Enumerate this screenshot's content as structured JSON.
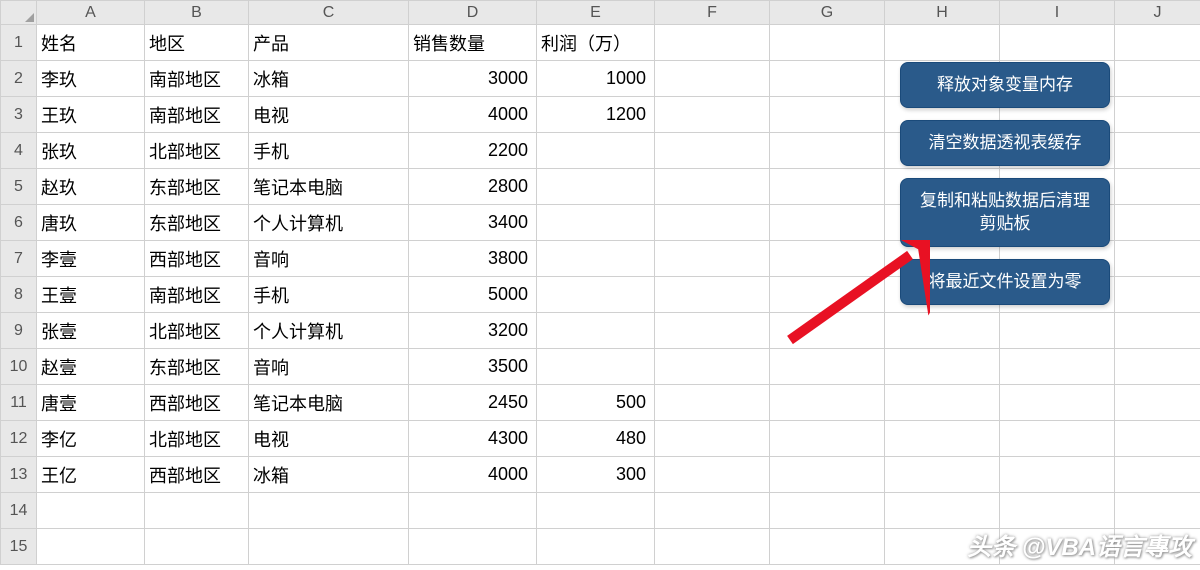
{
  "columns": [
    "A",
    "B",
    "C",
    "D",
    "E",
    "F",
    "G",
    "H",
    "I",
    "J"
  ],
  "rowCount": 15,
  "headers": {
    "c1": "姓名",
    "c2": "地区",
    "c3": "产品",
    "c4": "销售数量",
    "c5": "利润（万）"
  },
  "rows": [
    {
      "name": "李玖",
      "region": "南部地区",
      "product": "冰箱",
      "qty": "3000",
      "profit": "1000"
    },
    {
      "name": "王玖",
      "region": "南部地区",
      "product": "电视",
      "qty": "4000",
      "profit": "1200"
    },
    {
      "name": "张玖",
      "region": "北部地区",
      "product": "手机",
      "qty": "2200",
      "profit": ""
    },
    {
      "name": "赵玖",
      "region": "东部地区",
      "product": "笔记本电脑",
      "qty": "2800",
      "profit": ""
    },
    {
      "name": "唐玖",
      "region": "东部地区",
      "product": "个人计算机",
      "qty": "3400",
      "profit": ""
    },
    {
      "name": "李壹",
      "region": "西部地区",
      "product": "音响",
      "qty": "3800",
      "profit": ""
    },
    {
      "name": "王壹",
      "region": "南部地区",
      "product": "手机",
      "qty": "5000",
      "profit": ""
    },
    {
      "name": "张壹",
      "region": "北部地区",
      "product": "个人计算机",
      "qty": "3200",
      "profit": ""
    },
    {
      "name": "赵壹",
      "region": "东部地区",
      "product": "音响",
      "qty": "3500",
      "profit": ""
    },
    {
      "name": "唐壹",
      "region": "西部地区",
      "product": "笔记本电脑",
      "qty": "2450",
      "profit": "500"
    },
    {
      "name": "李亿",
      "region": "北部地区",
      "product": "电视",
      "qty": "4300",
      "profit": "480"
    },
    {
      "name": "王亿",
      "region": "西部地区",
      "product": "冰箱",
      "qty": "4000",
      "profit": "300"
    }
  ],
  "buttons": {
    "b1": "释放对象变量内存",
    "b2": "清空数据透视表缓存",
    "b3": "复制和粘贴数据后清理剪贴板",
    "b4": "将最近文件设置为零"
  },
  "watermark": "头条 @VBA语言專攻",
  "chart_data": {
    "type": "table",
    "title": "",
    "columns": [
      "姓名",
      "地区",
      "产品",
      "销售数量",
      "利润（万）"
    ],
    "data": [
      [
        "李玖",
        "南部地区",
        "冰箱",
        3000,
        1000
      ],
      [
        "王玖",
        "南部地区",
        "电视",
        4000,
        1200
      ],
      [
        "张玖",
        "北部地区",
        "手机",
        2200,
        null
      ],
      [
        "赵玖",
        "东部地区",
        "笔记本电脑",
        2800,
        null
      ],
      [
        "唐玖",
        "东部地区",
        "个人计算机",
        3400,
        null
      ],
      [
        "李壹",
        "西部地区",
        "音响",
        3800,
        null
      ],
      [
        "王壹",
        "南部地区",
        "手机",
        5000,
        null
      ],
      [
        "张壹",
        "北部地区",
        "个人计算机",
        3200,
        null
      ],
      [
        "赵壹",
        "东部地区",
        "音响",
        3500,
        null
      ],
      [
        "唐壹",
        "西部地区",
        "笔记本电脑",
        2450,
        500
      ],
      [
        "李亿",
        "北部地区",
        "电视",
        4300,
        480
      ],
      [
        "王亿",
        "西部地区",
        "冰箱",
        4000,
        300
      ]
    ]
  }
}
